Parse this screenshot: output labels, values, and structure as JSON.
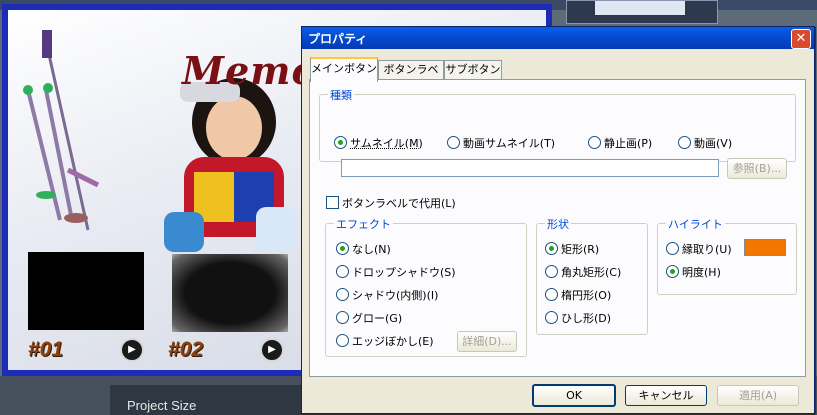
{
  "background": {
    "memo_text": "Memo",
    "thumb_labels": [
      "#01",
      "#02"
    ],
    "project_size_label": "Project Size"
  },
  "dialog": {
    "title": "プロパティ",
    "tabs": [
      "メインボタン",
      "ボタンラベル",
      "サブボタン"
    ],
    "active_tab": "メインボタン",
    "type_group": {
      "title": "種類",
      "options": [
        "サムネイル(M)",
        "動画サムネイル(T)",
        "静止画(P)",
        "動画(V)"
      ],
      "selected": "サムネイル(M)",
      "path_value": "",
      "browse_label": "参照(B)..."
    },
    "use_label_checkbox": {
      "label": "ボタンラベルで代用(L)",
      "checked": false
    },
    "effect_group": {
      "title": "エフェクト",
      "options": [
        "なし(N)",
        "ドロップシャドウ(S)",
        "シャドウ(内側)(I)",
        "グロー(G)",
        "エッジぼかし(E)"
      ],
      "selected": "なし(N)",
      "detail_label": "詳細(D)..."
    },
    "shape_group": {
      "title": "形状",
      "options": [
        "矩形(R)",
        "角丸矩形(C)",
        "楕円形(O)",
        "ひし形(D)"
      ],
      "selected": "矩形(R)"
    },
    "highlight_group": {
      "title": "ハイライト",
      "options": [
        "縁取り(U)",
        "明度(H)"
      ],
      "selected": "明度(H)",
      "swatch_color": "#f17700"
    },
    "buttons": {
      "ok": "OK",
      "cancel": "キャンセル",
      "apply": "適用(A)"
    }
  }
}
